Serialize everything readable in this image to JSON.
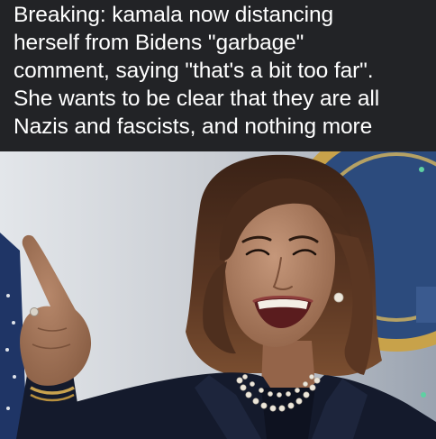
{
  "caption": {
    "lines": [
      "Breaking: kamala now distancing",
      "herself from Bidens \"garbage\"",
      "comment, saying \"that's a bit too far\".",
      "She wants to be clear that they are all",
      "Nazis and fascists, and nothing more"
    ]
  },
  "photo": {
    "subject": "woman-pointing-and-laughing",
    "colors": {
      "background_wall": "#c9cdd3",
      "background_seal_blue": "#2c4b7d",
      "background_seal_gold": "#c8a24a",
      "hair": "#4a2c1c",
      "skin": "#a97a5b",
      "jacket": "#141a2c",
      "pearls": "#ece6da"
    }
  },
  "theme": {
    "panel_background": "#222326",
    "caption_text": "#ffffff"
  }
}
